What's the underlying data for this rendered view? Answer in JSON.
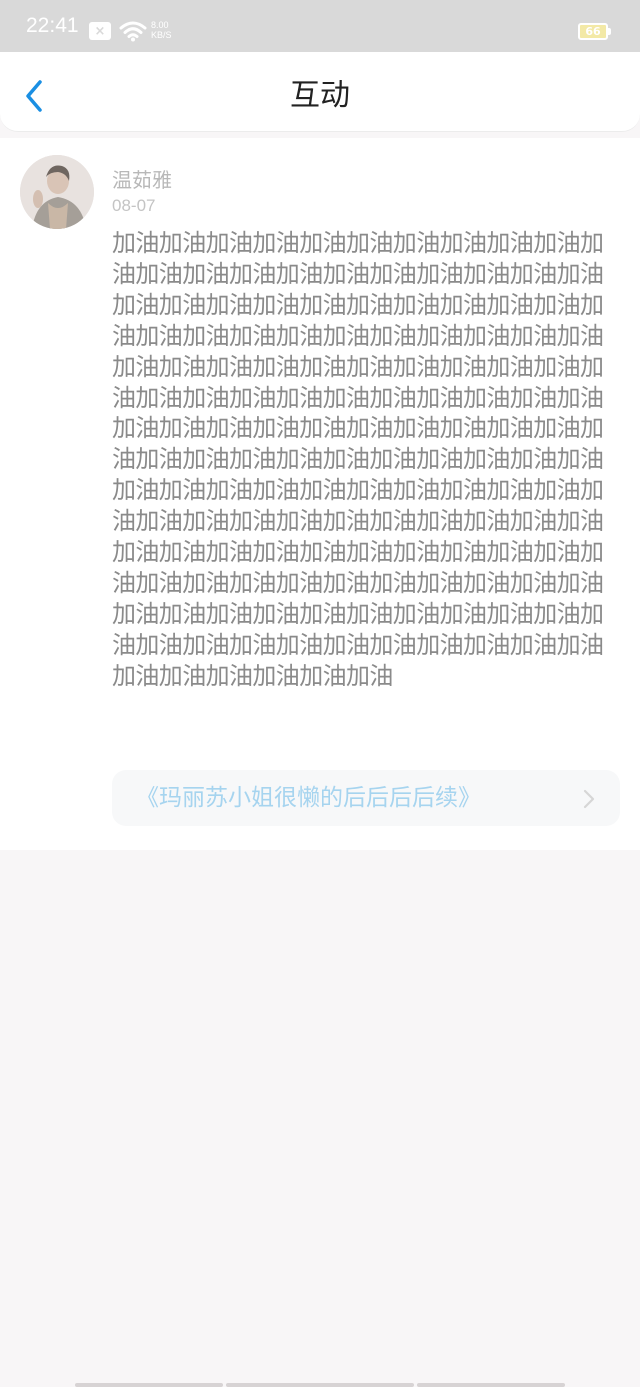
{
  "status_bar": {
    "time": "22:41",
    "notification_badge": "×",
    "network_speed_value": "8.00",
    "network_speed_unit": "KB/S",
    "battery_level": "66",
    "battery_color": "#f3e9a6"
  },
  "header": {
    "back_icon": "chevron-left-icon",
    "title": "互动",
    "accent_color": "#1a8fe3"
  },
  "comment": {
    "username": "温茹雅",
    "date": "08-07",
    "text": "加油加油加油加油加油加油加油加油加油加油加油加油加油加油加油加油加油加油加油加油加油加油加油加油加油加油加油加油加油加油加油加油加油加油加油加油加油加油加油加油加油加油加油加油加油加油加油加油加油加油加油加油加油加油加油加油加油加油加油加油加油加油加油加油加油加油加油加油加油加油加油加油加油加油加油加油加油加油加油加油加油加油加油加油加油加油加油加油加油加油加油加油加油加油加油加油加油加油加油加油加油加油加油加油加油加油加油加油加油加油加油加油加油加油加油加油加油加油加油加油加油加油加油加油加油加油加油加油加油加油加油加油加油加油加油加油加油加油加油加油加油加油加油加油加油加油加油加油加油加油加油加油加油",
    "book_title": "《玛丽苏小姐很懒的后后后后续》",
    "book_link_icon": "chevron-right-icon",
    "book_title_color": "#a6d4ef"
  }
}
